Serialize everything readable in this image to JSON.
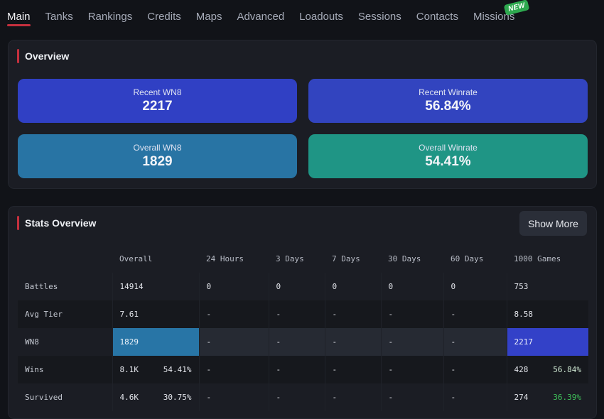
{
  "nav": {
    "items": [
      {
        "label": "Main",
        "active": true
      },
      {
        "label": "Tanks"
      },
      {
        "label": "Rankings"
      },
      {
        "label": "Credits"
      },
      {
        "label": "Maps"
      },
      {
        "label": "Advanced"
      },
      {
        "label": "Loadouts"
      },
      {
        "label": "Sessions"
      },
      {
        "label": "Contacts"
      },
      {
        "label": "Missions",
        "badge": "NEW"
      }
    ]
  },
  "overview": {
    "title": "Overview",
    "tiles": [
      {
        "label": "Recent WN8",
        "value": "2217",
        "color": "#3040c4"
      },
      {
        "label": "Recent Winrate",
        "value": "56.84%",
        "color": "#3244bf"
      },
      {
        "label": "Overall WN8",
        "value": "1829",
        "color": "#2874a4"
      },
      {
        "label": "Overall Winrate",
        "value": "54.41%",
        "color": "#1f9585"
      }
    ]
  },
  "stats": {
    "title": "Stats Overview",
    "show_more_label": "Show More",
    "columns": [
      "",
      "Overall",
      "24 Hours",
      "3 Days",
      "7 Days",
      "30 Days",
      "60 Days",
      "1000 Games"
    ],
    "rows": [
      {
        "label": "Battles",
        "cells": [
          "14914",
          "0",
          "0",
          "0",
          "0",
          "0",
          "753"
        ]
      },
      {
        "label": "Avg Tier",
        "cells": [
          "7.61",
          "-",
          "-",
          "-",
          "-",
          "-",
          "8.58"
        ]
      },
      {
        "label": "WN8",
        "cells": [
          "1829",
          "-",
          "-",
          "-",
          "-",
          "-",
          "2217"
        ]
      },
      {
        "label": "Wins",
        "cells": [
          "8.1K",
          "-",
          "-",
          "-",
          "-",
          "-",
          "428"
        ],
        "overall_pct": "54.41%",
        "recent_pct": "56.84%"
      },
      {
        "label": "Survived",
        "cells": [
          "4.6K",
          "-",
          "-",
          "-",
          "-",
          "-",
          "274"
        ],
        "overall_pct": "30.75%",
        "recent_pct": "36.39%"
      }
    ],
    "colors": {
      "overall_highlight": "#2875a6",
      "recent_highlight": "#3341c8",
      "good_pct": "#3fc25a"
    }
  }
}
